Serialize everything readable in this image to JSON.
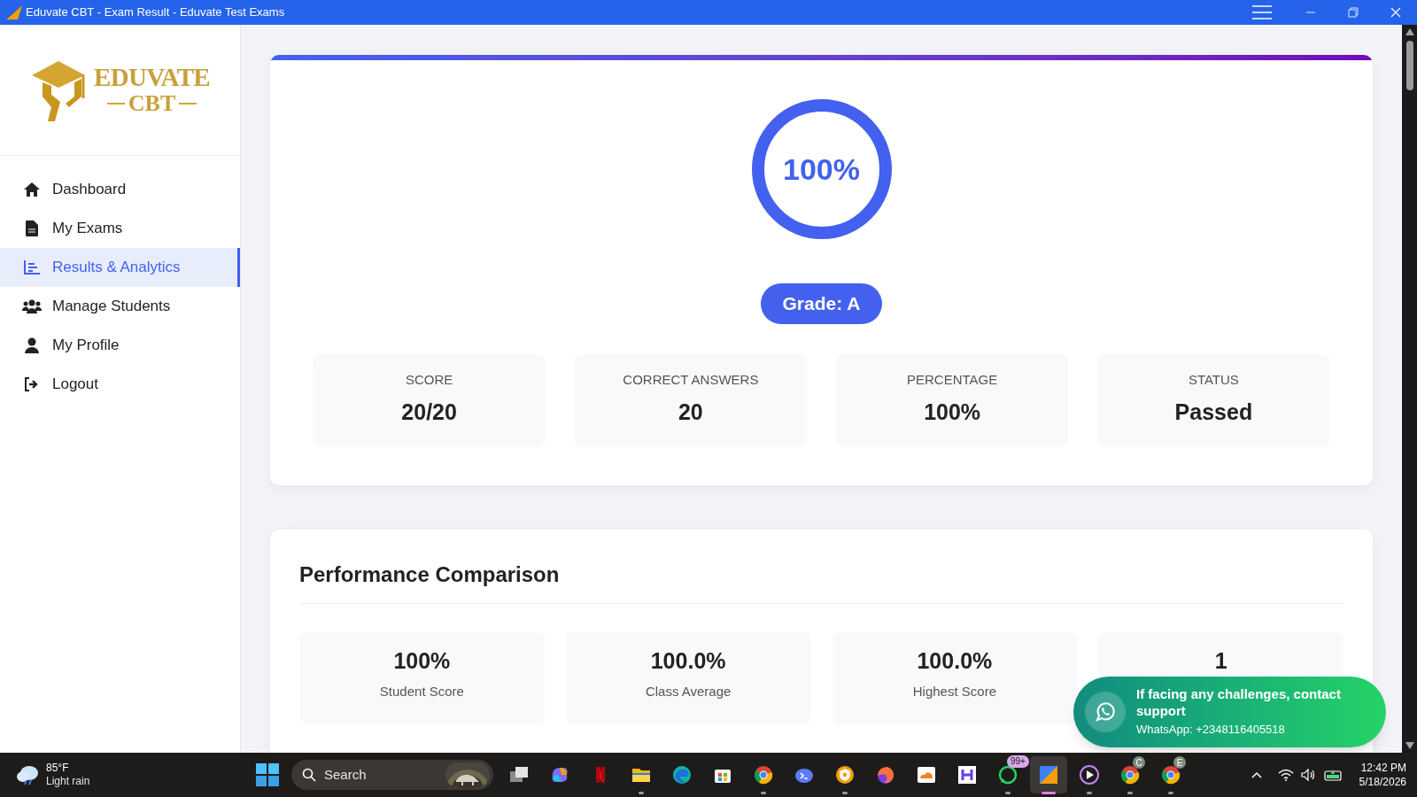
{
  "window": {
    "title": "Eduvate CBT - Exam Result - Eduvate Test Exams"
  },
  "logo": {
    "line1": "EDUVATE",
    "line2": "CBT"
  },
  "sidebar": {
    "items": [
      {
        "kind": "home",
        "label": "Dashboard",
        "selected": false
      },
      {
        "kind": "file",
        "label": "My Exams",
        "selected": false
      },
      {
        "kind": "chart",
        "label": "Results & Analytics",
        "selected": true
      },
      {
        "kind": "users",
        "label": "Manage Students",
        "selected": false
      },
      {
        "kind": "user",
        "label": "My Profile",
        "selected": false
      },
      {
        "kind": "logout",
        "label": "Logout",
        "selected": false
      }
    ]
  },
  "result": {
    "percent": "100%",
    "level": 1,
    "grade": "Grade: A",
    "stats": [
      {
        "label": "SCORE",
        "value": "20/20"
      },
      {
        "label": "CORRECT ANSWERS",
        "value": "20"
      },
      {
        "label": "PERCENTAGE",
        "value": "100%"
      },
      {
        "label": "STATUS",
        "value": "Passed"
      }
    ]
  },
  "comparison": {
    "title": "Performance Comparison",
    "cards": [
      {
        "value": "100%",
        "label": "Student Score"
      },
      {
        "value": "100.0%",
        "label": "Class Average"
      },
      {
        "value": "100.0%",
        "label": "Highest Score"
      },
      {
        "value": "1"
      }
    ]
  },
  "support_popup": {
    "title": "If facing any challenges, contact support",
    "contact": "WhatsApp: +2348116405518"
  },
  "taskbar": {
    "weather": {
      "temp": "85°F",
      "condition": "Light rain"
    },
    "search": {
      "placeholder": "Search"
    },
    "apps": [
      {
        "kind": "taskview",
        "running": false,
        "selected": false
      },
      {
        "kind": "copilot",
        "running": false,
        "selected": false
      },
      {
        "kind": "ribbon",
        "running": false,
        "selected": false
      },
      {
        "kind": "folder",
        "running": true,
        "selected": false
      },
      {
        "kind": "edge",
        "running": false,
        "selected": false
      },
      {
        "kind": "store",
        "running": false,
        "selected": false
      },
      {
        "kind": "chrome",
        "running": true,
        "selected": false
      },
      {
        "kind": "cloudterm",
        "running": false,
        "selected": false
      },
      {
        "kind": "shield",
        "running": true,
        "selected": false
      },
      {
        "kind": "firefox",
        "running": false,
        "selected": false
      },
      {
        "kind": "cloud",
        "running": false,
        "selected": false
      },
      {
        "kind": "hbox",
        "running": false,
        "selected": false
      },
      {
        "kind": "whatsapp",
        "running": true,
        "selected": false,
        "badge": "99+"
      },
      {
        "kind": "eduvate",
        "running": true,
        "selected": true
      },
      {
        "kind": "play",
        "running": true,
        "selected": false
      },
      {
        "kind": "chrome",
        "running": true,
        "selected": false,
        "badge": "C"
      },
      {
        "kind": "chrome",
        "running": true,
        "selected": false,
        "badge": "E"
      }
    ],
    "time": "12:42 PM",
    "date": "5/18/2026"
  }
}
